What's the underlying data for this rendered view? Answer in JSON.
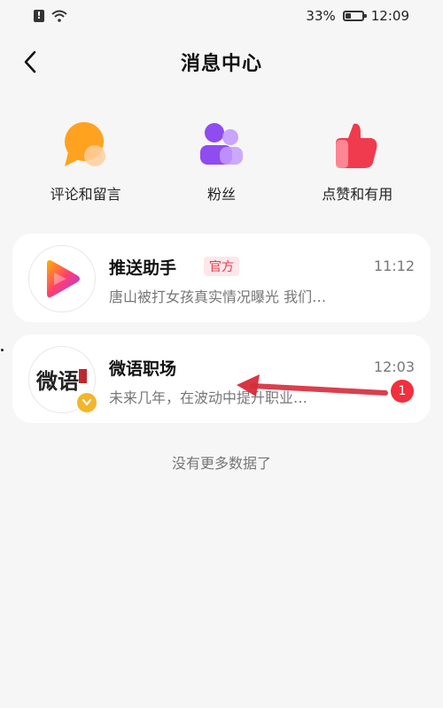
{
  "status_bar": {
    "battery": "33%",
    "battery_level": 0.33,
    "time": "12:09",
    "icons": [
      "alert-icon",
      "wifi-icon",
      "battery-icon"
    ]
  },
  "header": {
    "title": "消息中心",
    "back_icon": "chevron-left-icon"
  },
  "categories": [
    {
      "label": "评论和留言",
      "icon": "comment-bubble-icon",
      "color": "#ff9c1a"
    },
    {
      "label": "粉丝",
      "icon": "fans-people-icon",
      "color": "#9b5cf6"
    },
    {
      "label": "点赞和有用",
      "icon": "thumbs-up-icon",
      "color": "#f03b4e"
    }
  ],
  "messages": [
    {
      "name": "推送助手",
      "tag": "官方",
      "time": "11:12",
      "preview": "唐山被打女孩真实情况曝光 我们…",
      "avatar_icon": "play-logo-icon"
    },
    {
      "name": "微语职场",
      "time": "12:03",
      "preview": "未来几年，在波动中提升职业…",
      "unread": "1",
      "avatar_icon": "calligraphy-logo-icon",
      "avatar_text": "微语",
      "verified_icon": "chevron-down-icon"
    }
  ],
  "footer_text": "没有更多数据了",
  "colors": {
    "background": "#f6f6f6",
    "accent_red": "#f12f3d",
    "official_bg": "#fde7ea",
    "official_text": "#e53b4e",
    "vip_gold": "#f3b52a"
  }
}
